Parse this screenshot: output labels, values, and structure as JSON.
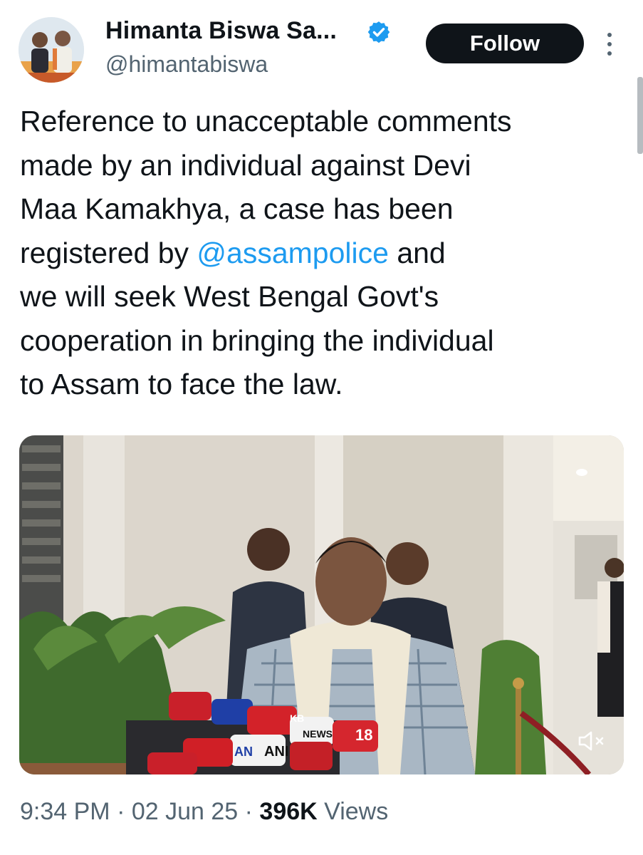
{
  "author": {
    "display_name": "Himanta Biswa Sa...",
    "handle": "@himantabiswa",
    "verified_icon": "verified-badge-icon",
    "verified_color": "#1d9bf0"
  },
  "actions": {
    "follow_label": "Follow",
    "more_icon": "more-vertical-icon"
  },
  "tweet": {
    "lines": [
      "Reference to unacceptable comments",
      "made by an individual against Devi",
      "Maa Kamakhya, a case has been"
    ],
    "line4_before": "registered by ",
    "mention": "@assampolice",
    "line4_after": " and",
    "lines_end": [
      "we will seek West Bengal Govt's",
      "cooperation in bringing the individual",
      "to Assam to face the law."
    ]
  },
  "media": {
    "type": "video",
    "mute_icon": "speaker-muted-icon",
    "mic_labels": [
      "18",
      "ANI",
      "AN",
      "NEWS",
      "KB"
    ]
  },
  "meta": {
    "time": "9:34 PM",
    "sep1": " · ",
    "date": "02 Jun 25",
    "sep2": " · ",
    "views_count": "396K",
    "views_label": " Views"
  },
  "colors": {
    "text": "#0f1419",
    "secondary": "#536471",
    "link": "#1d9bf0",
    "button_bg": "#0f1419"
  }
}
